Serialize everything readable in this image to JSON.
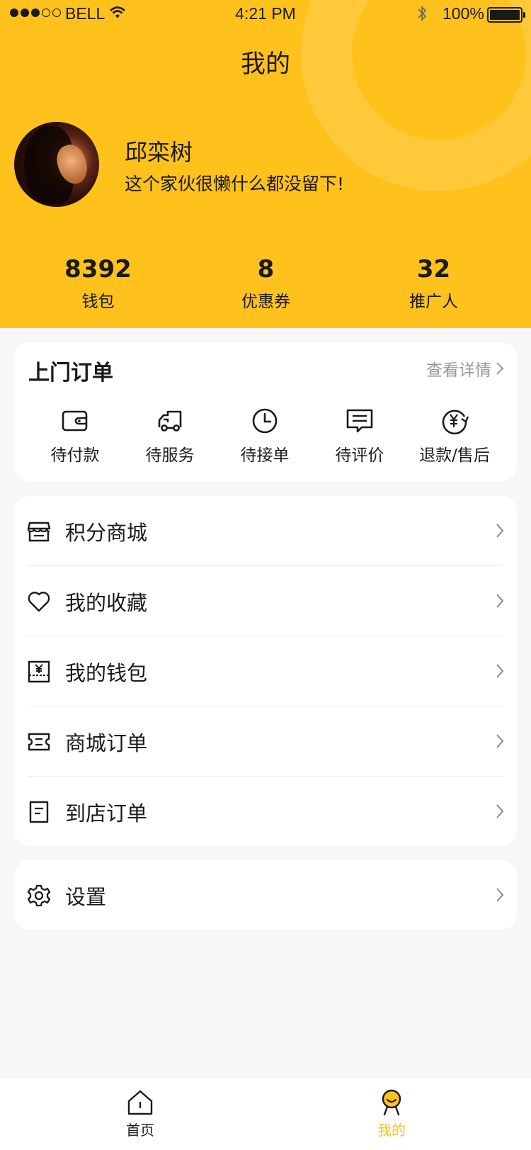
{
  "status_bar": {
    "carrier": "BELL",
    "time": "4:21 PM",
    "battery": "100%"
  },
  "header": {
    "title": "我的"
  },
  "profile": {
    "name": "邱栾树",
    "bio": "这个家伙很懒什么都没留下!"
  },
  "stats": [
    {
      "value": "8392",
      "label": "钱包"
    },
    {
      "value": "8",
      "label": "优惠券"
    },
    {
      "value": "32",
      "label": "推广人"
    }
  ],
  "orders": {
    "title": "上门订单",
    "more_label": "查看详情",
    "items": [
      {
        "label": "待付款",
        "icon": "wallet-icon"
      },
      {
        "label": "待服务",
        "icon": "truck-icon"
      },
      {
        "label": "待接单",
        "icon": "clock-icon"
      },
      {
        "label": "待评价",
        "icon": "comment-icon"
      },
      {
        "label": "退款/售后",
        "icon": "refund-icon"
      }
    ]
  },
  "menu": [
    {
      "label": "积分商城",
      "icon": "store-icon"
    },
    {
      "label": "我的收藏",
      "icon": "heart-icon"
    },
    {
      "label": "我的钱包",
      "icon": "wallet-card-icon"
    },
    {
      "label": "商城订单",
      "icon": "ticket-icon"
    },
    {
      "label": "到店订单",
      "icon": "document-icon"
    }
  ],
  "settings": {
    "label": "设置",
    "icon": "gear-icon"
  },
  "tabbar": {
    "home_label": "首页",
    "mine_label": "我的",
    "active_color": "#ffc21c",
    "inactive_color": "#1a1a1a"
  },
  "colors": {
    "accent": "#ffc21c",
    "background": "#f7f7f7"
  }
}
